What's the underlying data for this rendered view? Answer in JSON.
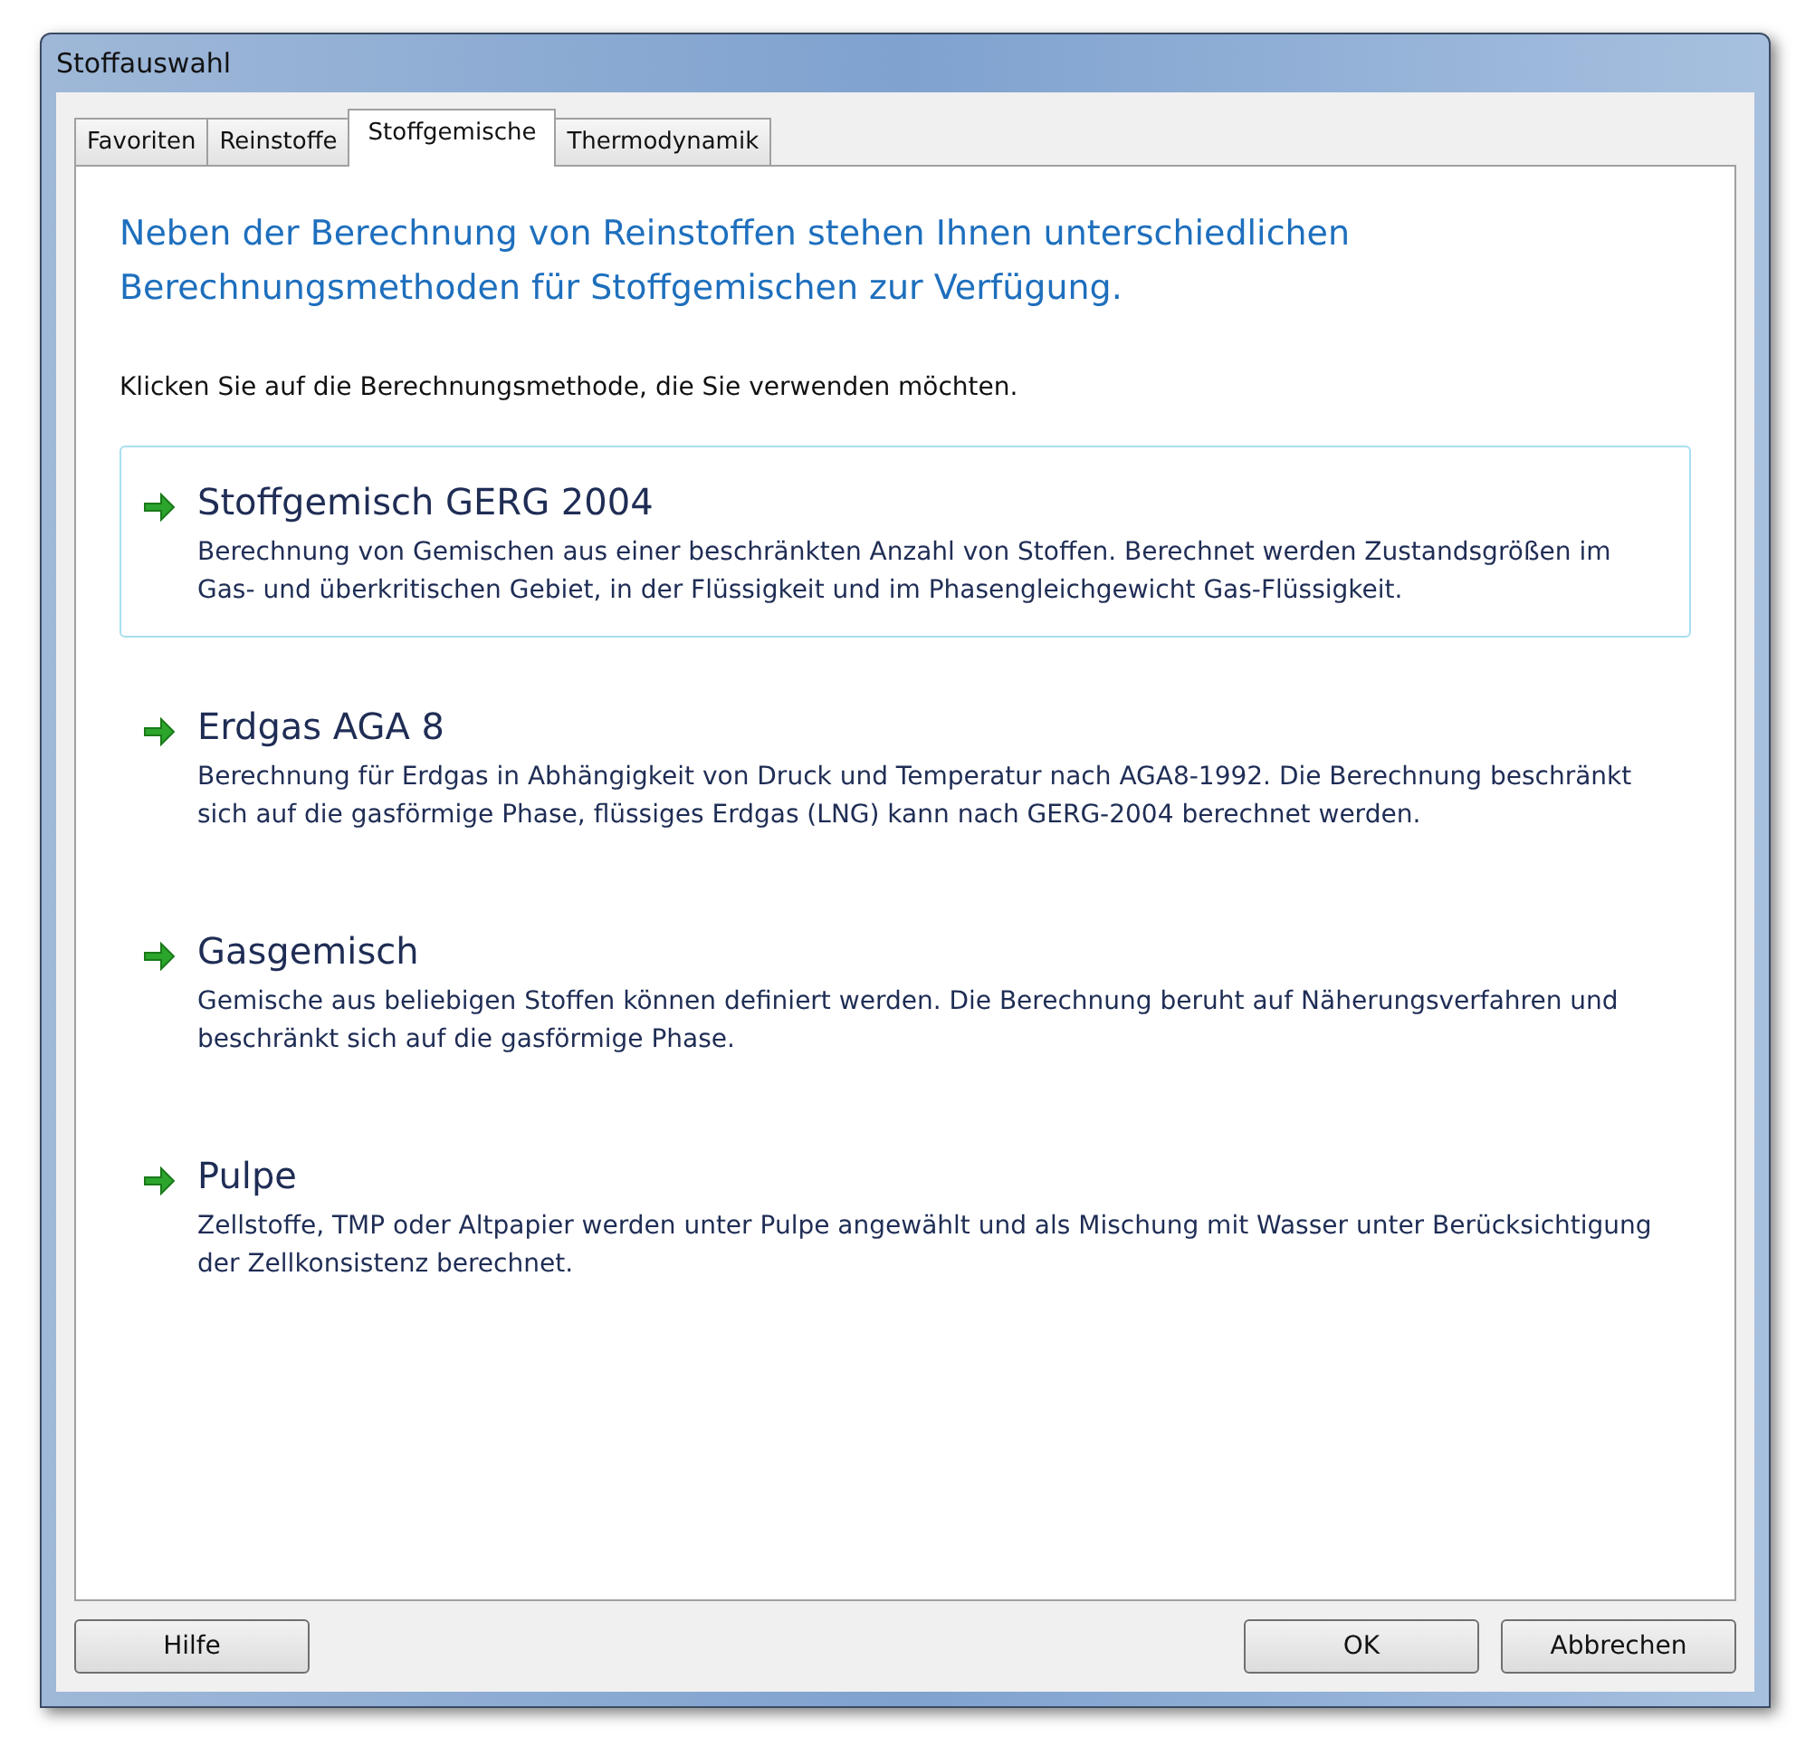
{
  "window": {
    "title": "Stoffauswahl"
  },
  "tabs": [
    {
      "label": "Favoriten",
      "selected": false
    },
    {
      "label": "Reinstoffe",
      "selected": false
    },
    {
      "label": "Stoffgemische",
      "selected": true
    },
    {
      "label": "Thermodynamik",
      "selected": false
    }
  ],
  "intro": "Neben der Berechnung von Reinstoffen stehen Ihnen unterschiedlichen Berechnungsmethoden für Stoffgemischen zur Verfügung.",
  "instruction": "Klicken Sie auf die Berechnungsmethode, die Sie verwenden möchten.",
  "methods": [
    {
      "title": "Stoffgemisch GERG 2004",
      "description": "Berechnung von Gemischen aus einer beschränkten Anzahl von Stoffen. Berechnet werden Zustandsgrößen im Gas- und überkritischen Gebiet, in der Flüssigkeit und im Phasengleichgewicht Gas-Flüssigkeit.",
      "selected": true
    },
    {
      "title": "Erdgas AGA 8",
      "description": "Berechnung für Erdgas in Abhängigkeit von Druck und Temperatur nach AGA8-1992.  Die Berechnung beschränkt sich auf die gasförmige Phase, flüssiges Erdgas (LNG) kann nach GERG-2004 berechnet werden.",
      "selected": false
    },
    {
      "title": "Gasgemisch",
      "description": "Gemische aus beliebigen Stoffen können definiert werden.  Die Berechnung beruht auf Näherungsverfahren und beschränkt sich auf die gasförmige Phase.",
      "selected": false
    },
    {
      "title": "Pulpe",
      "description": "Zellstoffe, TMP oder Altpapier werden unter Pulpe angewählt und als Mischung mit Wasser unter Berücksichtigung der Zellkonsistenz berechnet.",
      "selected": false
    }
  ],
  "buttons": {
    "left": [
      "Hilfe"
    ],
    "right": [
      "OK",
      "Abbrechen"
    ]
  }
}
